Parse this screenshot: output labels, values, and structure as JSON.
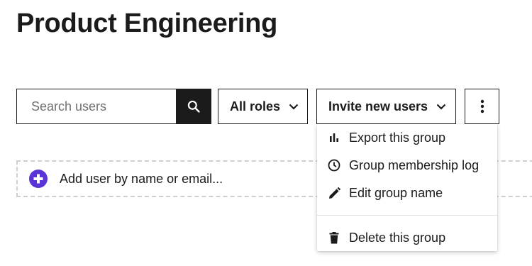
{
  "header": {
    "title": "Product Engineering"
  },
  "toolbar": {
    "search": {
      "placeholder": "Search users",
      "value": "",
      "icon": "search-icon"
    },
    "roles_filter": {
      "label": "All roles",
      "icon": "chevron-down-icon"
    },
    "invite": {
      "label": "Invite new users",
      "icon": "chevron-down-icon"
    },
    "more": {
      "icon": "more-vertical-icon"
    }
  },
  "add_user": {
    "label": "Add user by name or email...",
    "icon": "add-circle-icon",
    "icon_color": "#5b34d8"
  },
  "more_menu": {
    "items": [
      {
        "label": "Export this group",
        "icon": "bar-chart-icon"
      },
      {
        "label": "Group membership log",
        "icon": "clock-icon"
      },
      {
        "label": "Edit group name",
        "icon": "pencil-icon"
      }
    ],
    "danger_items": [
      {
        "label": "Delete this group",
        "icon": "trash-icon"
      }
    ]
  },
  "colors": {
    "text": "#1b1b1b",
    "accent": "#5b34d8",
    "border_dashed": "#cfcfcf"
  }
}
